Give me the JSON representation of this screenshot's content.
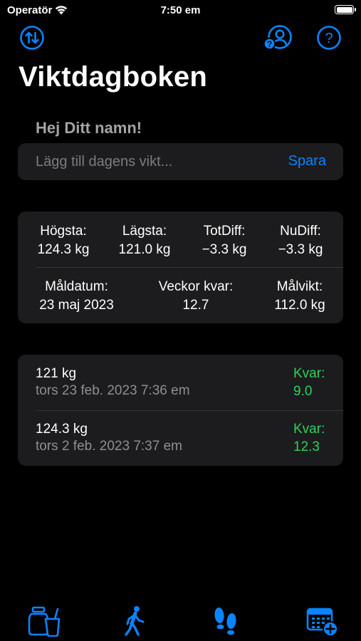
{
  "status_bar": {
    "carrier": "Operatör",
    "time": "7:50 em"
  },
  "header": {
    "title": "Viktdagboken"
  },
  "greeting": "Hej Ditt namn!",
  "weight_entry": {
    "placeholder": "Lägg till dagens vikt...",
    "save_label": "Spara"
  },
  "stats": {
    "highest_label": "Högsta:",
    "highest_value": "124.3 kg",
    "lowest_label": "Lägsta:",
    "lowest_value": "121.0 kg",
    "totdiff_label": "TotDiff:",
    "totdiff_value": "−3.3 kg",
    "nudiff_label": "NuDiff:",
    "nudiff_value": "−3.3 kg",
    "goal_date_label": "Måldatum:",
    "goal_date_value": "23 maj 2023",
    "weeks_left_label": "Veckor kvar:",
    "weeks_left_value": "12.7",
    "goal_weight_label": "Målvikt:",
    "goal_weight_value": "112.0 kg"
  },
  "entries": [
    {
      "weight": "121 kg",
      "date": "tors 23 feb. 2023 7:36 em",
      "remaining_label": "Kvar:",
      "remaining_value": "9.0"
    },
    {
      "weight": "124.3 kg",
      "date": "tors 2 feb. 2023 7:37 em",
      "remaining_label": "Kvar:",
      "remaining_value": "12.3"
    }
  ],
  "icons": {
    "sort": "arrow-up-down-circle-icon",
    "profile": "person-question-icon",
    "help": "question-circle-icon",
    "tab1": "food-drink-icon",
    "tab2": "walking-person-icon",
    "tab3": "footprints-icon",
    "tab4": "calendar-add-icon"
  },
  "colors": {
    "accent": "#0a84ff",
    "positive": "#30d158",
    "card": "#1c1c1e",
    "background": "#000000"
  }
}
